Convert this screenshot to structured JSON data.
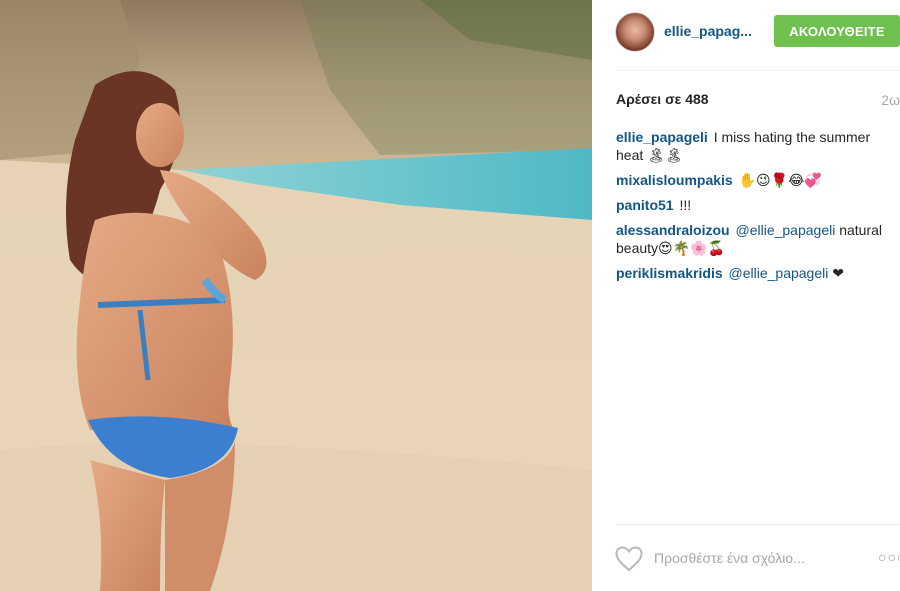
{
  "post": {
    "photo_description": "",
    "author": "ellie_papag...",
    "follow_label": "ΑΚΟΛΟΥΘΕΙΤΕ",
    "likes": "Αρέσει σε 488",
    "timestamp": "2ω"
  },
  "comments": [
    {
      "author": "ellie_papageli",
      "text": "I miss hating the summer heat ",
      "emoji": "🏝🏝"
    },
    {
      "author": "mixalisloumpakis",
      "text": "",
      "emoji": "✋😉🌹😂💞"
    },
    {
      "author": "panito51",
      "text": "!!!",
      "emoji": ""
    },
    {
      "author": "alessandraloizou",
      "mention": "@ellie_papageli",
      "text": " natural beauty",
      "emoji": "😍🌴🌸🍒"
    },
    {
      "author": "periklismakridis",
      "mention": "@ellie_papageli",
      "text": " ",
      "emoji": "❤"
    }
  ],
  "footer": {
    "comment_placeholder": "Προσθέστε ένα σχόλιο...",
    "more_label": "○○○",
    "heart_icon": "heart-outline-icon",
    "more_icon": "more-dots-icon"
  },
  "colors": {
    "follow_button": "#70c050",
    "username": "#125688",
    "muted": "#a5a7aa"
  }
}
